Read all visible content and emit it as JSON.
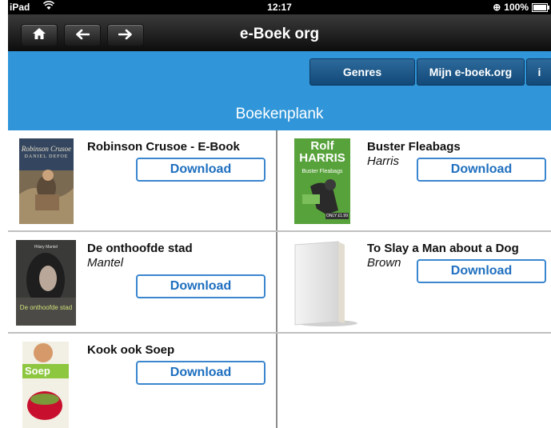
{
  "status": {
    "carrier": "iPad",
    "time": "12:17",
    "battery": "100%",
    "battery_level": 1.0
  },
  "navbar": {
    "title": "e-Boek org",
    "home_icon": "home-icon",
    "back_icon": "arrow-left-icon",
    "forward_icon": "arrow-right-icon"
  },
  "toolbar": {
    "genres": "Genres",
    "mine": "Mijn e-boek.org",
    "info": "i"
  },
  "shelf": {
    "title": "Boekenplank"
  },
  "download_label": "Download",
  "books": [
    {
      "title": "Robinson Crusoe - E-Book",
      "author": "",
      "cover_title": "Robinson Crusoe",
      "cover_author": "DANIEL DEFOE"
    },
    {
      "title": "Buster Fleabags",
      "author": "Harris",
      "cover_title": "Rolf HARRIS",
      "cover_sub": "Buster Fleabags",
      "cover_price": "ONLY £1.99"
    },
    {
      "title": "De onthoofde stad",
      "author": "Mantel",
      "cover_author": "Hilary Mantel",
      "cover_title": "De onthoofde stad"
    },
    {
      "title": "To Slay a Man about a Dog",
      "author": "Brown"
    },
    {
      "title": "Kook ook Soep",
      "author": "",
      "cover_title": "Soep"
    }
  ],
  "colors": {
    "accent": "#3196d9",
    "button_border": "#3a86cf",
    "button_text": "#1e6fbf",
    "toolbar_button": "#1a568a"
  }
}
